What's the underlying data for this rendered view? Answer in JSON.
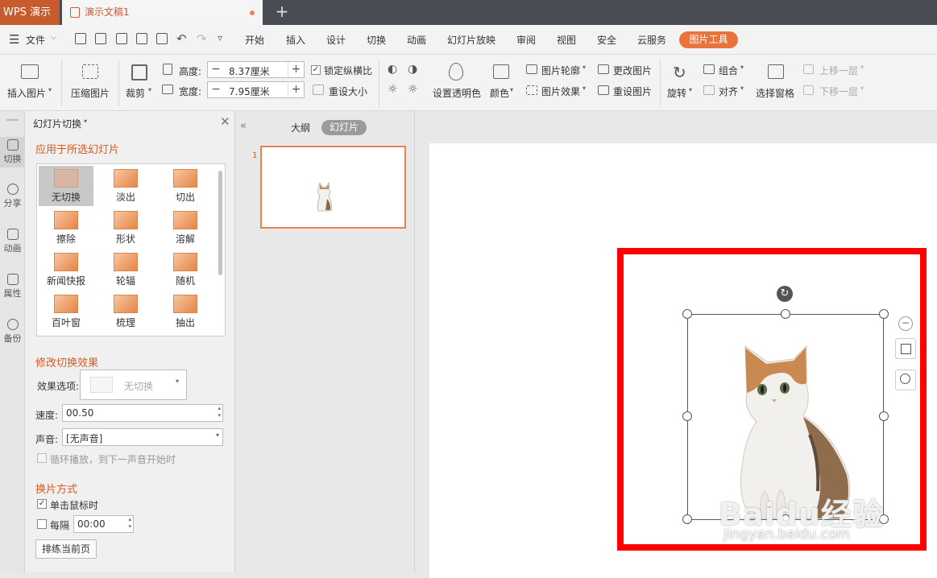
{
  "titlebar": {
    "app_name": "WPS 演示",
    "doc_tab": "演示文稿1",
    "new_tab": "+"
  },
  "menubar": {
    "file": "文件",
    "items": [
      "开始",
      "插入",
      "设计",
      "切换",
      "动画",
      "幻灯片放映",
      "审阅",
      "视图",
      "安全",
      "云服务"
    ],
    "active_tool": "图片工具"
  },
  "ribbon": {
    "insert_picture": "插入图片",
    "compress_picture": "压缩图片",
    "crop": "裁剪",
    "height_label": "高度:",
    "height_value": "8.37厘米",
    "width_label": "宽度:",
    "width_value": "7.95厘米",
    "lock_ratio": "锁定纵横比",
    "reset_size": "重设大小",
    "set_transparent": "设置透明色",
    "color": "颜色",
    "picture_outline": "图片轮廓",
    "picture_effect": "图片效果",
    "change_picture": "更改图片",
    "reset_picture": "重设图片",
    "rotate": "旋转",
    "group": "组合",
    "align": "对齐",
    "selection_pane": "选择窗格",
    "bring_forward": "上移一层",
    "send_backward": "下移一层"
  },
  "rail": {
    "items": [
      "切换",
      "分享",
      "动画",
      "属性",
      "备份"
    ]
  },
  "transition_panel": {
    "title": "幻灯片切换",
    "apply_heading": "应用于所选幻灯片",
    "transitions": [
      "无切换",
      "淡出",
      "切出",
      "擦除",
      "形状",
      "溶解",
      "新闻快报",
      "轮辐",
      "随机",
      "百叶窗",
      "梳理",
      "抽出"
    ],
    "selected": "无切换",
    "modify_heading": "修改切换效果",
    "effect_label": "效果选项:",
    "effect_value": "无切换",
    "speed_label": "速度:",
    "speed_value": "00.50",
    "sound_label": "声音:",
    "sound_value": "[无声音]",
    "loop_label": "循环播放，到下一声音开始时",
    "advance_heading": "换片方式",
    "on_click_label": "单击鼠标时",
    "every_label": "每隔",
    "every_value": "00:00",
    "rehearse_button": "排练当前页"
  },
  "thumbs": {
    "tab_outline": "大纲",
    "tab_slides": "幻灯片",
    "slide_number": "1"
  },
  "colors": {
    "accent": "#e8743b",
    "title_bar": "#494c53",
    "app_tab": "#c85b2e",
    "highlight_frame": "#ff0000"
  },
  "watermark": {
    "brand": "Baidu经验",
    "url": "jingyan.baidu.com"
  }
}
